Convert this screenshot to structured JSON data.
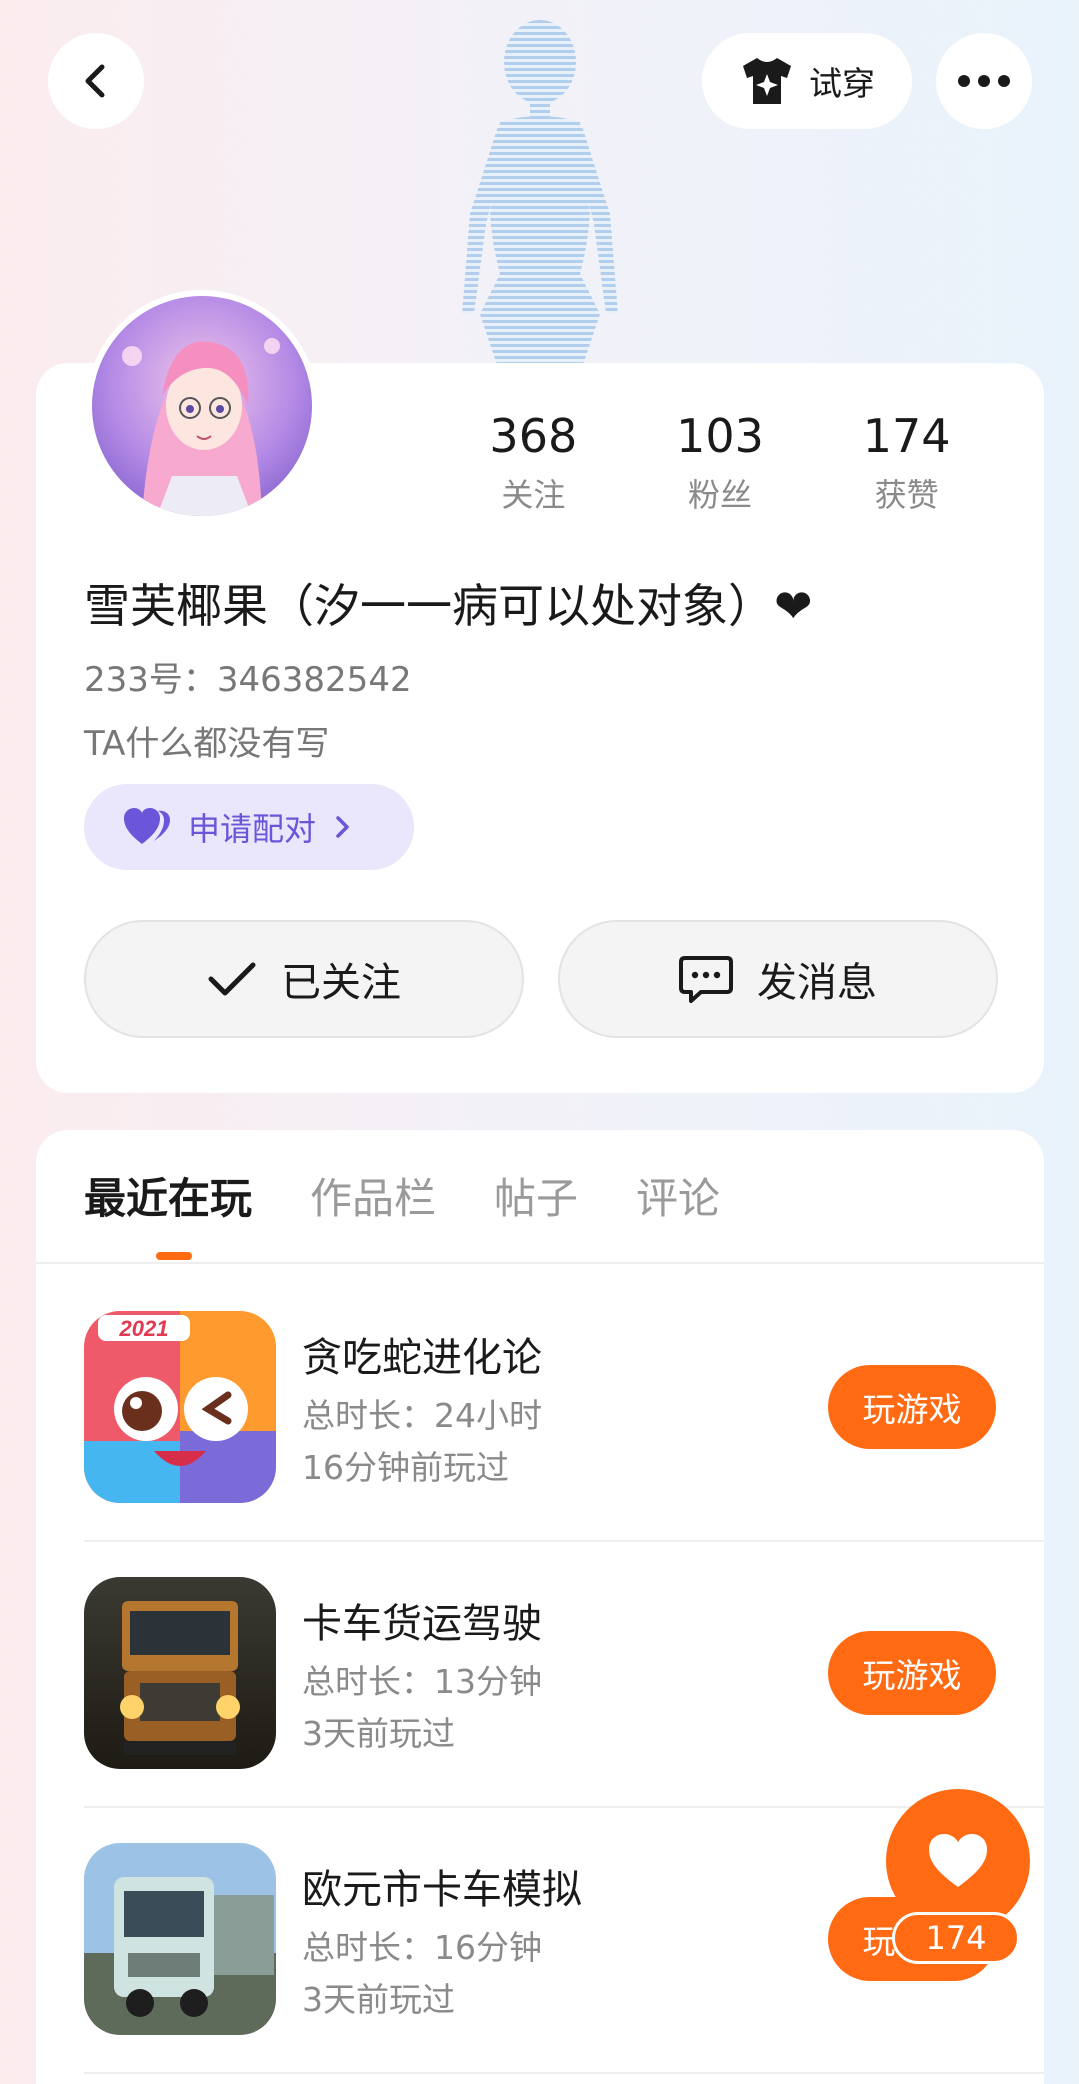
{
  "header": {
    "tryon_label": "试穿",
    "icons": {
      "back": "chevron-left-icon",
      "tryon": "tshirt-sparkle-icon",
      "more": "more-dots-icon"
    }
  },
  "profile": {
    "stats": [
      {
        "value": "368",
        "label": "关注"
      },
      {
        "value": "103",
        "label": "粉丝"
      },
      {
        "value": "174",
        "label": "获赞"
      }
    ],
    "username": "雪芙椰果（汐一一病可以处对象）❤",
    "uid": "233号：346382542",
    "bio": "TA什么都没有写",
    "pair_label": "申请配对",
    "follow_label": "已关注",
    "message_label": "发消息"
  },
  "tabs": [
    {
      "label": "最近在玩",
      "active": true
    },
    {
      "label": "作品栏",
      "active": false
    },
    {
      "label": "帖子",
      "active": false
    },
    {
      "label": "评论",
      "active": false
    }
  ],
  "games": [
    {
      "name": "贪吃蛇进化论",
      "duration": "总时长：24小时",
      "last_played": "16分钟前玩过",
      "button": "玩游戏",
      "icon_badge": "2021"
    },
    {
      "name": "卡车货运驾驶",
      "duration": "总时长：13分钟",
      "last_played": "3天前玩过",
      "button": "玩游戏"
    },
    {
      "name": "欧元市卡车模拟",
      "duration": "总时长：16分钟",
      "last_played": "3天前玩过",
      "button": "玩游戏"
    }
  ],
  "float_like": {
    "count": "174"
  },
  "colors": {
    "accent": "#ff6a13",
    "pair": "#6b55d8",
    "pair_bg": "#eae6fb"
  }
}
